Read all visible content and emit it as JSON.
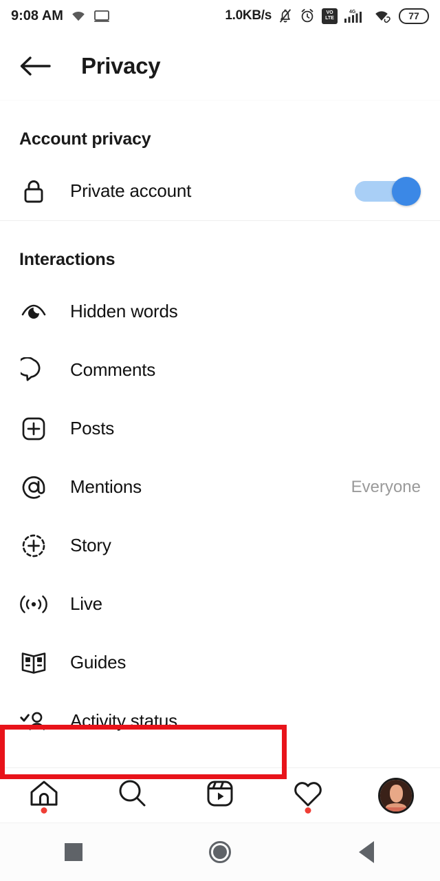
{
  "statusbar": {
    "time": "9:08 AM",
    "wifi_left_icon": "wifi-icon",
    "cast_icon": "cast-screen-icon",
    "network_speed": "1.0KB/s",
    "mute_icon": "bell-muted-icon",
    "alarm_icon": "alarm-clock-icon",
    "volte_line1": "VO",
    "volte_line2": "LTE",
    "signal_label": "4G",
    "signal_icon": "cellular-signal-icon",
    "wifi_right_icon": "wifi-connected-icon",
    "battery_level": "77"
  },
  "header": {
    "back_icon": "back-arrow-icon",
    "title": "Privacy"
  },
  "sections": [
    {
      "title": "Account privacy",
      "rows": [
        {
          "label": "Private account",
          "icon": "lock-icon",
          "control": "toggle",
          "toggle_on": true
        }
      ]
    },
    {
      "title": "Interactions",
      "rows": [
        {
          "label": "Hidden words",
          "icon": "hidden-words-eye-icon",
          "value": ""
        },
        {
          "label": "Comments",
          "icon": "comment-bubble-icon",
          "value": ""
        },
        {
          "label": "Posts",
          "icon": "post-plus-icon",
          "value": ""
        },
        {
          "label": "Mentions",
          "icon": "mention-at-icon",
          "value": "Everyone"
        },
        {
          "label": "Story",
          "icon": "story-plus-icon",
          "value": ""
        },
        {
          "label": "Live",
          "icon": "live-broadcast-icon",
          "value": ""
        },
        {
          "label": "Guides",
          "icon": "guides-book-icon",
          "value": ""
        },
        {
          "label": "Activity status",
          "icon": "activity-status-person-check-icon",
          "value": ""
        }
      ]
    }
  ],
  "highlight": {
    "target": "Activity status",
    "color": "#e8131a"
  },
  "tabbar": {
    "items": [
      {
        "name": "home",
        "icon": "home-icon",
        "badge": true
      },
      {
        "name": "search",
        "icon": "search-icon",
        "badge": false
      },
      {
        "name": "reels",
        "icon": "reels-icon",
        "badge": false
      },
      {
        "name": "activity",
        "icon": "heart-icon",
        "badge": true
      },
      {
        "name": "profile",
        "icon": "profile-avatar",
        "badge": false
      }
    ]
  },
  "androidnav": {
    "recents_icon": "recents-square-icon",
    "home_icon": "home-circle-icon",
    "back_icon": "back-triangle-icon"
  },
  "colors": {
    "toggle_track": "#a9cff6",
    "toggle_thumb": "#3b88e6",
    "highlight": "#e8131a",
    "badge": "#ef3e35",
    "value_text": "#9a9a9a"
  }
}
